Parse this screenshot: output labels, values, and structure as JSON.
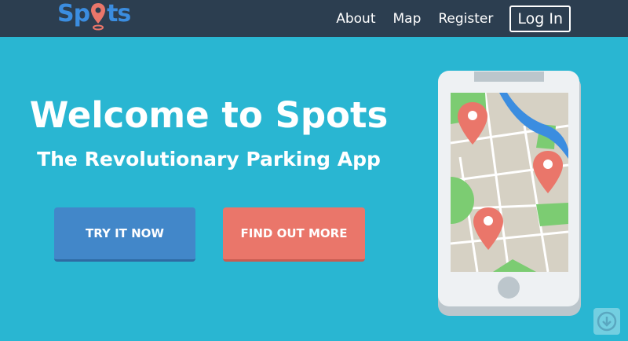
{
  "nav": {
    "logo_text_left": "Sp",
    "logo_text_right": "ts",
    "links": [
      {
        "label": "About"
      },
      {
        "label": "Map"
      },
      {
        "label": "Register"
      }
    ],
    "login_label": "Log In"
  },
  "hero": {
    "title": "Welcome to Spots",
    "subtitle": "The Revolutionary Parking App",
    "cta_primary": "TRY IT NOW",
    "cta_secondary": "FIND OUT MORE"
  },
  "icons": {
    "logo_pin": "map-pin-icon",
    "scroll_down": "arrow-down-circle-icon"
  },
  "colors": {
    "background": "#29b6d2",
    "navbar": "#2c3e50",
    "logo": "#3b8de0",
    "pin": "#ea766a",
    "primary_button": "#4287c9",
    "secondary_button": "#ea766a"
  }
}
